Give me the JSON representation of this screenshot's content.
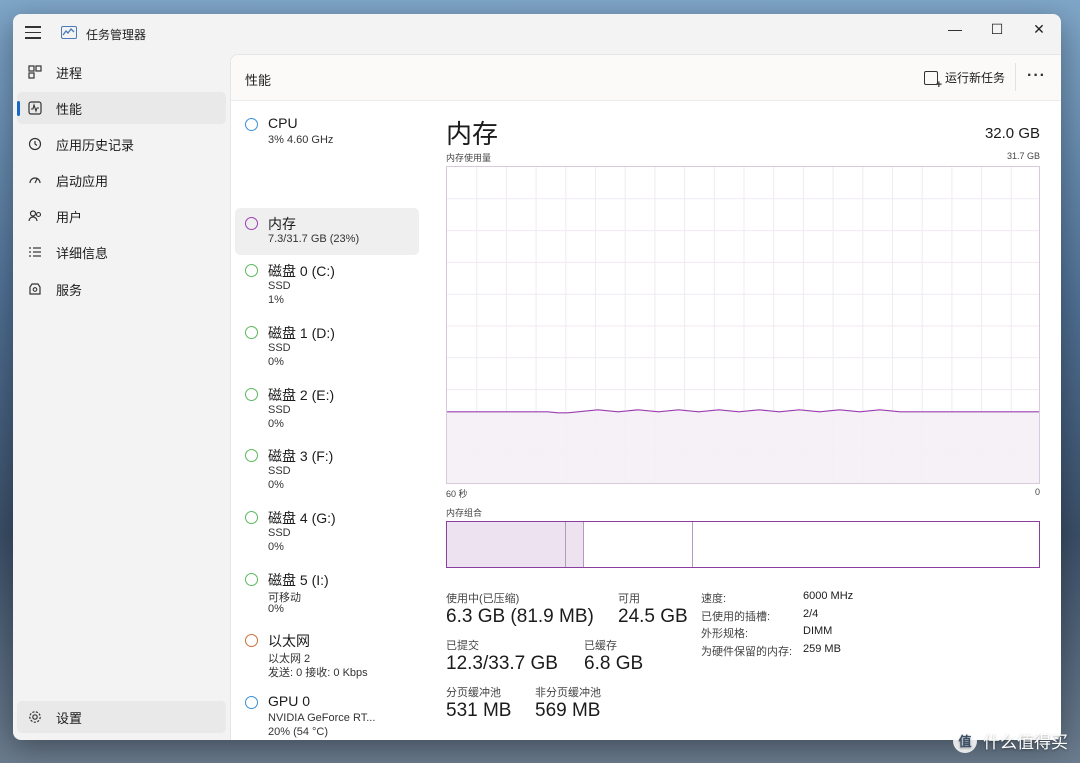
{
  "window": {
    "title": "任务管理器",
    "controls": {
      "minimize": "—",
      "maximize": "☐",
      "close": "✕"
    }
  },
  "sidebar": {
    "items": [
      {
        "label": "进程",
        "icon": "processes-icon"
      },
      {
        "label": "性能",
        "icon": "performance-icon",
        "active": true
      },
      {
        "label": "应用历史记录",
        "icon": "history-icon"
      },
      {
        "label": "启动应用",
        "icon": "startup-icon"
      },
      {
        "label": "用户",
        "icon": "users-icon"
      },
      {
        "label": "详细信息",
        "icon": "details-icon"
      },
      {
        "label": "服务",
        "icon": "services-icon"
      }
    ],
    "settings_label": "设置"
  },
  "header": {
    "title": "性能",
    "run_task_label": "运行新任务",
    "more_label": "···"
  },
  "devices": [
    {
      "name": "CPU",
      "line1": "3%  4.60 GHz",
      "line2": "",
      "color": "#3a8fd6"
    },
    {
      "name": "内存",
      "line1": "7.3/31.7 GB (23%)",
      "line2": "",
      "color": "#9b3fb0",
      "active": true
    },
    {
      "name": "磁盘 0 (C:)",
      "line1": "SSD",
      "line2": "1%",
      "color": "#5cb85c"
    },
    {
      "name": "磁盘 1 (D:)",
      "line1": "SSD",
      "line2": "0%",
      "color": "#5cb85c"
    },
    {
      "name": "磁盘 2 (E:)",
      "line1": "SSD",
      "line2": "0%",
      "color": "#5cb85c"
    },
    {
      "name": "磁盘 3 (F:)",
      "line1": "SSD",
      "line2": "0%",
      "color": "#5cb85c"
    },
    {
      "name": "磁盘 4 (G:)",
      "line1": "SSD",
      "line2": "0%",
      "color": "#5cb85c"
    },
    {
      "name": "磁盘 5 (I:)",
      "line1": "可移动",
      "line2": "0%",
      "color": "#5cb85c"
    },
    {
      "name": "以太网",
      "line1": "以太网 2",
      "line2": "发送: 0 接收: 0 Kbps",
      "color": "#c9713a"
    },
    {
      "name": "GPU 0",
      "line1": "NVIDIA GeForce RT...",
      "line2": "20% (54 °C)",
      "color": "#3a8fd6"
    }
  ],
  "memory": {
    "title": "内存",
    "total": "32.0 GB",
    "usage_label": "内存使用量",
    "usage_max": "31.7 GB",
    "x_left": "60 秒",
    "x_right": "0",
    "composition_label": "内存组合",
    "composition": {
      "in_use_fraction": 0.2,
      "modified_fraction": 0.03,
      "standby_fraction": 0.185,
      "free_fraction": 0.585
    },
    "stats": {
      "in_use_label": "使用中(已压缩)",
      "in_use_value": "6.3 GB (81.9 MB)",
      "available_label": "可用",
      "available_value": "24.5 GB",
      "committed_label": "已提交",
      "committed_value": "12.3/33.7 GB",
      "cached_label": "已缓存",
      "cached_value": "6.8 GB",
      "paged_label": "分页缓冲池",
      "paged_value": "531 MB",
      "nonpaged_label": "非分页缓冲池",
      "nonpaged_value": "569 MB"
    },
    "details": [
      {
        "key": "速度:",
        "value": "6000 MHz"
      },
      {
        "key": "已使用的插槽:",
        "value": "2/4"
      },
      {
        "key": "外形规格:",
        "value": "DIMM"
      },
      {
        "key": "为硬件保留的内存:",
        "value": "259 MB"
      }
    ]
  },
  "chart_data": {
    "type": "area",
    "title": "内存使用量",
    "xlabel": "",
    "ylabel": "",
    "x_range": [
      "60 秒",
      "0"
    ],
    "ylim": [
      0,
      31.7
    ],
    "values": [
      7.3,
      7.3,
      7.3,
      7.3,
      7.3,
      7.3,
      7.3,
      7.3,
      7.3,
      7.3,
      7.3,
      7.2,
      7.2,
      7.3,
      7.4,
      7.5,
      7.4,
      7.3,
      7.4,
      7.5,
      7.4,
      7.3,
      7.4,
      7.5,
      7.4,
      7.3,
      7.4,
      7.5,
      7.4,
      7.3,
      7.4,
      7.5,
      7.4,
      7.3,
      7.4,
      7.5,
      7.4,
      7.3,
      7.4,
      7.5,
      7.4,
      7.3,
      7.4,
      7.5,
      7.4,
      7.3,
      7.3,
      7.3,
      7.3,
      7.3,
      7.3,
      7.3,
      7.3,
      7.3,
      7.3,
      7.3,
      7.3,
      7.3,
      7.3,
      7.3
    ],
    "grid": true,
    "color": "#9b3fb0"
  },
  "watermark": "什么值得买"
}
